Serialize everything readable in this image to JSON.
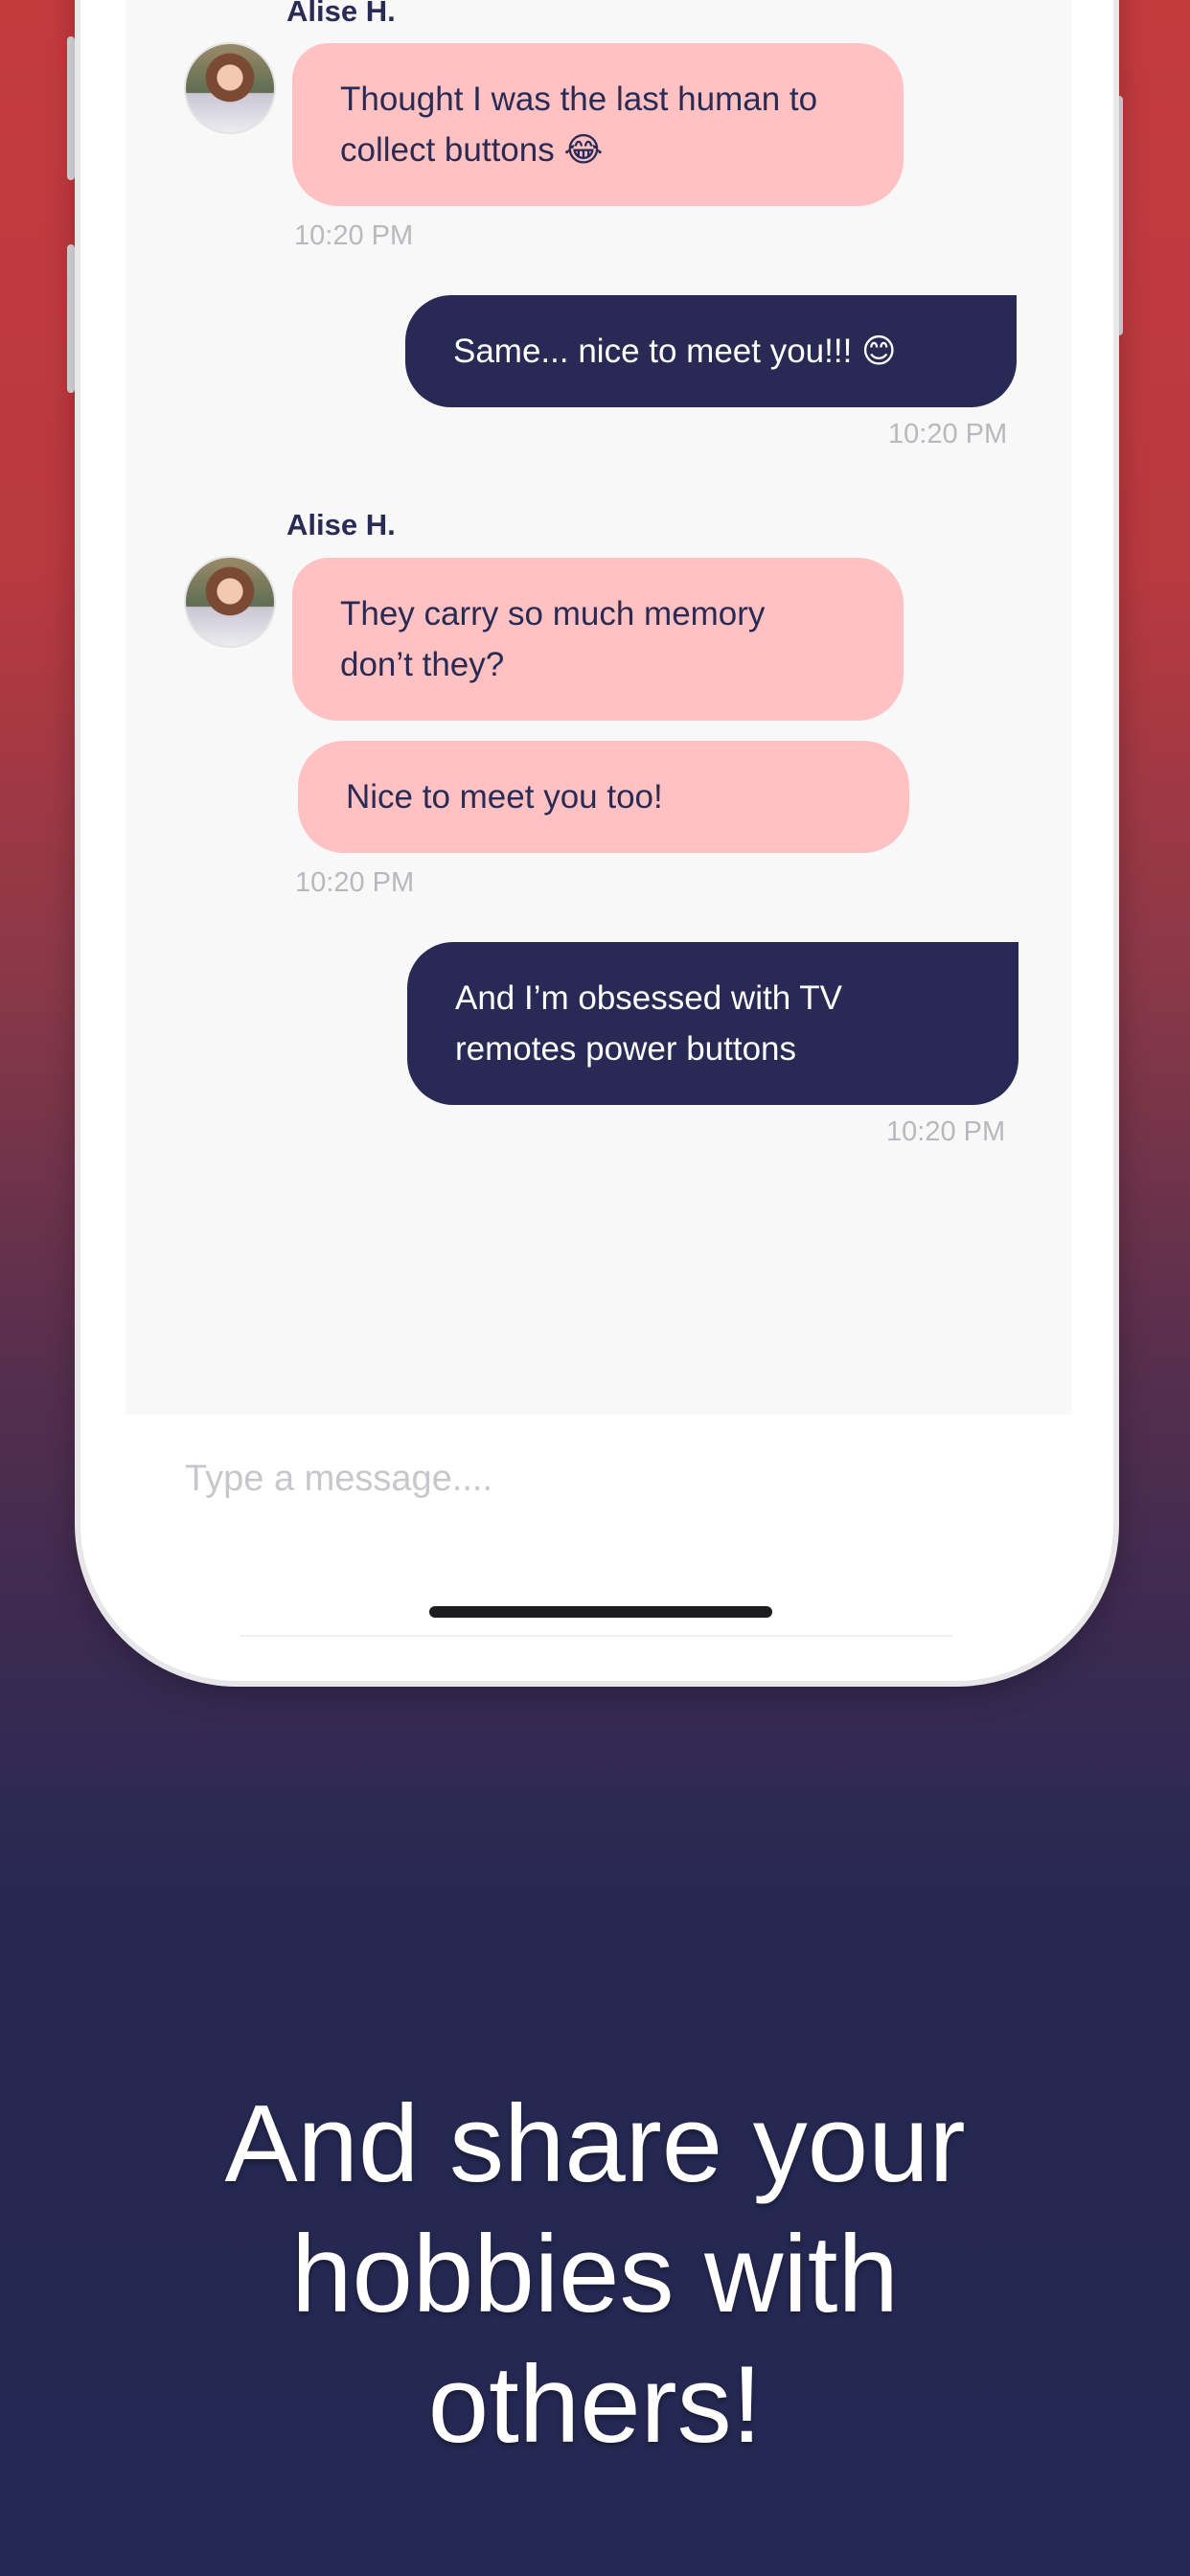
{
  "chat": {
    "messages": [
      {
        "sender": "Alise H.",
        "text_line1": "Thought I was the last human to",
        "text_line2": "collect buttons 😂",
        "time": "10:20 PM"
      },
      {
        "text": "Same... nice to meet you!!! 😊",
        "time": "10:20 PM"
      },
      {
        "sender": "Alise H.",
        "text_line1": "They carry so much memory",
        "text_line2": "don’t they?"
      },
      {
        "text": "Nice to meet you too!",
        "time": "10:20 PM"
      },
      {
        "text_line1": "And I’m obsessed with TV",
        "text_line2": "remotes power buttons",
        "time": "10:20 PM"
      }
    ],
    "input_placeholder": "Type a message...."
  },
  "headline": {
    "line1": "And share your",
    "line2": "hobbies with",
    "line3": "others!"
  },
  "colors": {
    "incoming_bubble": "#ffc1c1",
    "outgoing_bubble": "#282a55",
    "background_top": "#c43b3e",
    "background_bottom": "#252852"
  }
}
